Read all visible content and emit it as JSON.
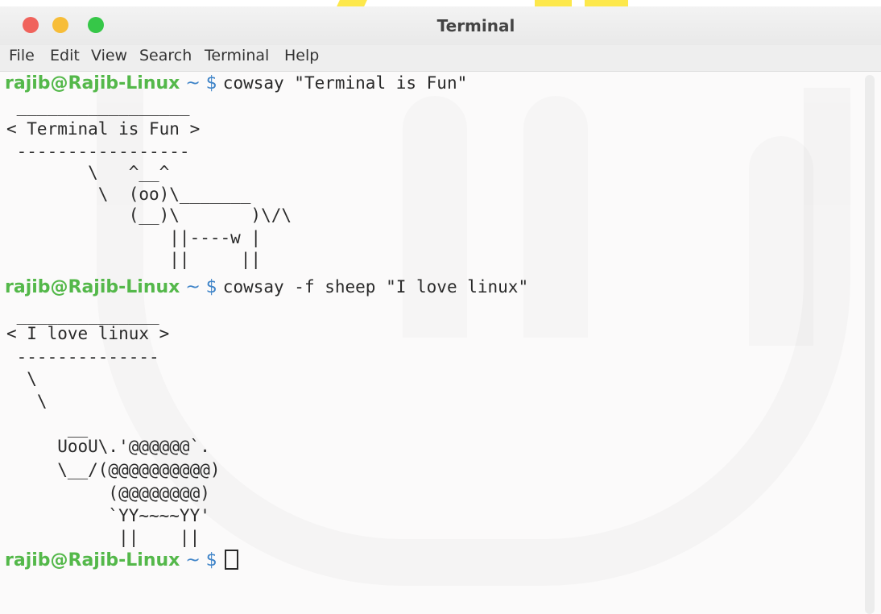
{
  "window": {
    "title": "Terminal",
    "controls": [
      "close",
      "minimize",
      "maximize"
    ]
  },
  "menu": [
    "File",
    "Edit",
    "View",
    "Search",
    "Terminal",
    "Help"
  ],
  "prompt": {
    "user_host": "rajib@Rajib-Linux",
    "path": "~",
    "symbol": "$"
  },
  "commands": [
    "cowsay \"Terminal is Fun\"",
    "cowsay -f sheep \"I love linux\""
  ],
  "output1": [
    " _________________",
    "< Terminal is Fun >",
    " -----------------",
    "        \\   ^__^",
    "         \\  (oo)\\_______",
    "            (__)\\       )\\/\\",
    "                ||----w |",
    "                ||     ||"
  ],
  "output2": [
    " ______________",
    "< I love linux >",
    " --------------",
    "  \\",
    "   \\",
    "      __",
    "     UooU\\.'@@@@@@`.",
    "     \\__/(@@@@@@@@@@)",
    "          (@@@@@@@@)",
    "          `YY~~~~YY'",
    "           ||    ||"
  ],
  "colors": {
    "user": "#54b84a",
    "path": "#3f84c8",
    "text": "#2a2a2a",
    "background": "#fbfafa"
  }
}
